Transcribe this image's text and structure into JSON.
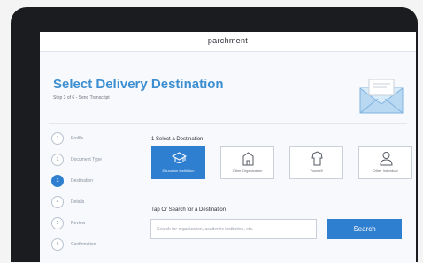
{
  "app": {
    "brand": "parchment"
  },
  "page": {
    "title": "Select Delivery Destination",
    "subtitle": "Step 3 of 6 - Send Transcript"
  },
  "steps": [
    {
      "number": "1",
      "label": "Profile",
      "active": false
    },
    {
      "number": "2",
      "label": "Document Type",
      "active": false
    },
    {
      "number": "3",
      "label": "Destination",
      "active": true
    },
    {
      "number": "4",
      "label": "Details",
      "active": false
    },
    {
      "number": "5",
      "label": "Review",
      "active": false
    },
    {
      "number": "6",
      "label": "Confirmation",
      "active": false
    }
  ],
  "destination": {
    "heading": "1 Select a Destination",
    "cards": [
      {
        "label": "Education Institution",
        "icon": "graduation-cap-icon",
        "selected": true
      },
      {
        "label": "Other Organization",
        "icon": "building-icon",
        "selected": false
      },
      {
        "label": "Yourself",
        "icon": "person-icon",
        "selected": false
      },
      {
        "label": "Other Individual",
        "icon": "user-icon",
        "selected": false
      }
    ]
  },
  "search": {
    "label": "Tap Or Search for a Destination",
    "placeholder": "Search for organization, academic institution, etc.",
    "button_label": "Search"
  },
  "colors": {
    "accent": "#2f7fd0",
    "title": "#3d8fd1",
    "bezel": "#1b1c1f"
  }
}
